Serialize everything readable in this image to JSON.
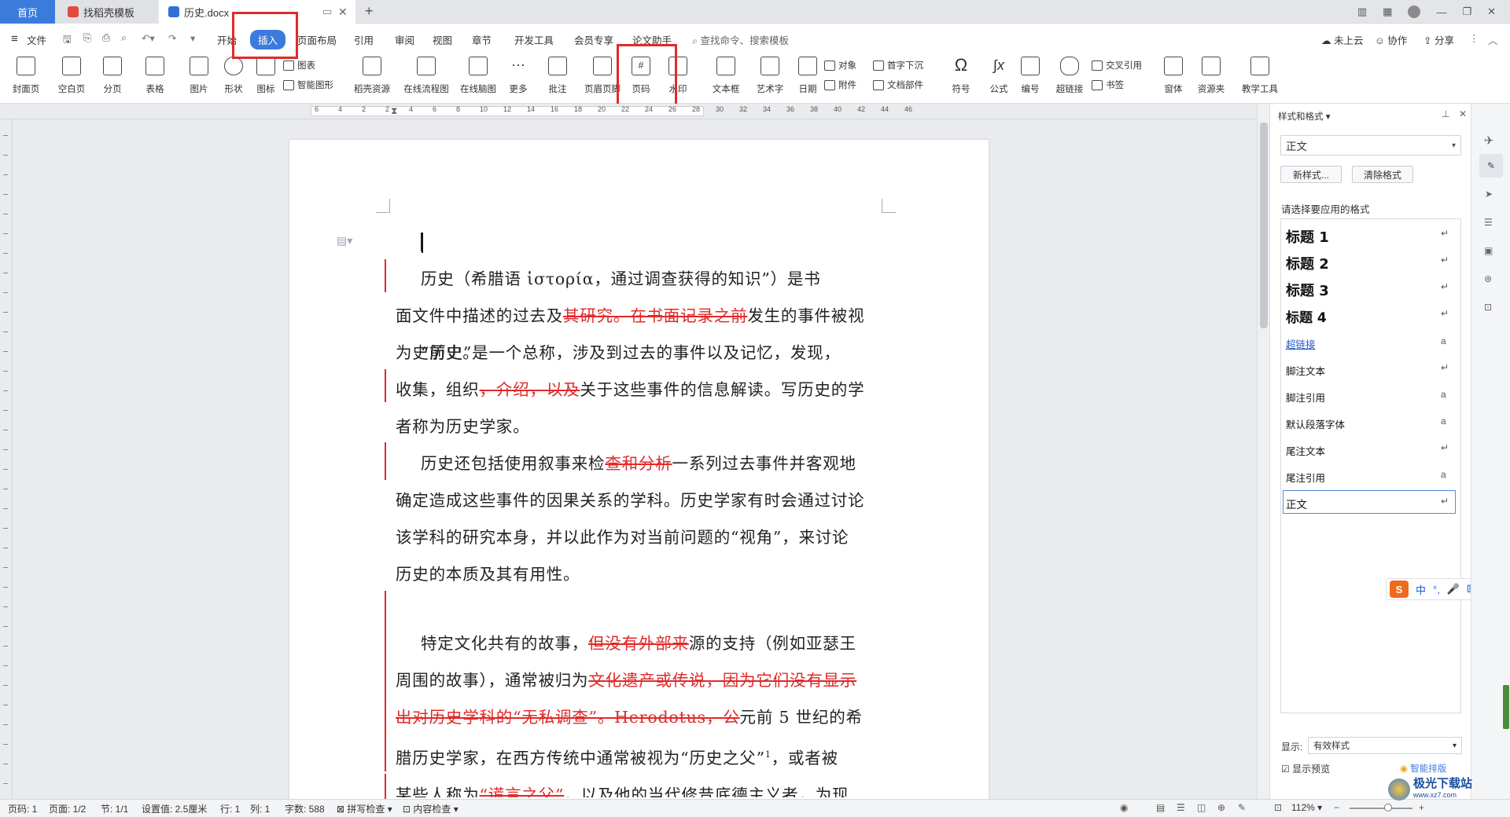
{
  "tabs": {
    "home": "首页",
    "template": "找稻壳模板",
    "doc": "历史.docx"
  },
  "menu": {
    "file": "文件",
    "items": [
      "开始",
      "插入",
      "页面布局",
      "引用",
      "审阅",
      "视图",
      "章节",
      "开发工具",
      "会员专享",
      "论文助手"
    ],
    "active": "插入",
    "search": "查找命令、搜索模板",
    "cloud": "未上云",
    "collab": "协作",
    "share": "分享"
  },
  "ribbon": {
    "cover": "封面页",
    "blank": "空白页",
    "pagebreak": "分页",
    "table": "表格",
    "picture": "图片",
    "shape": "形状",
    "icon": "图标",
    "chart": "图表",
    "smartart": "智能图形",
    "docer": "稻壳资源",
    "flowchart": "在线流程图",
    "mindmap": "在线脑图",
    "more": "更多",
    "comment": "批注",
    "header": "页眉页脚",
    "pagenum": "页码",
    "watermark": "水印",
    "textbox": "文本框",
    "wordart": "艺术字",
    "date": "日期",
    "object": "对象",
    "attach": "附件",
    "dropcap": "首字下沉",
    "docparts": "文档部件",
    "symbol": "符号",
    "formula": "公式",
    "numbering": "编号",
    "hyperlink": "超链接",
    "crossref": "交叉引用",
    "bookmark": "书签",
    "window": "窗体",
    "resources": "资源夹",
    "teaching": "教学工具"
  },
  "ruler": {
    "marks": [
      "6",
      "4",
      "2",
      "2",
      "4",
      "6",
      "8",
      "10",
      "12",
      "14",
      "16",
      "18",
      "20",
      "22",
      "24",
      "26",
      "28",
      "30",
      "32",
      "34",
      "36",
      "38",
      "40",
      "42",
      "44",
      "46"
    ]
  },
  "document": {
    "p1": [
      "历史（希腊语 ἱστορία，通过调查获得的知识”）是书",
      "面文件中描述的过去及",
      "其研究。在书面记录之前",
      "发生的事件被视",
      "为史前史。"
    ],
    "p2": [
      "“历史”是一个总称，涉及到过去的事件以及记忆，发现，",
      "收集，组织",
      "，介绍，以及",
      "关于这些事件的信息解读。写历史的学",
      "者称为历史学家。"
    ],
    "p3": [
      "历史还包括使用叙事来检",
      "查和分析",
      "一系列过去事件并客观地",
      "确定造成这些事件的因果关系的学科。历史学家有时会通过讨论",
      "该学科的研究本身，并以此作为对当前问题的“视角”，来讨论",
      "历史的本质及其有用性。"
    ],
    "p4": [
      "特定文化共有的故事，",
      "但没有外部来",
      "源的支持（例如亚瑟王",
      "周围的故事），通常被归为",
      "文化遗产或传说，因为它们没有显示",
      "出对历史学科的“无私调查”。Herodotus，公",
      "元前 5 世纪的希",
      "腊历史学家，在西方传统中通常被视为“历史之父”",
      "1",
      "，或者被",
      "某些人称为",
      "“谎言之父”",
      "，以及他的当代修昔底德主义者，为现"
    ]
  },
  "panel": {
    "title": "样式和格式",
    "current": "正文",
    "new_style": "新样式...",
    "clear": "清除格式",
    "prompt": "请选择要应用的格式",
    "styles": [
      "标题  1",
      "标题  2",
      "标题  3",
      "标题  4",
      "超链接",
      "脚注文本",
      "脚注引用",
      "默认段落字体",
      "尾注文本",
      "尾注引用",
      "正文"
    ],
    "show_label": "显示:",
    "show_value": "有效样式",
    "preview": "显示预览",
    "smart": "智能排版"
  },
  "ime": {
    "lang": "中"
  },
  "status": {
    "page": "页码: 1",
    "pages": "页面: 1/2",
    "section": "节: 1/1",
    "setting": "设置值: 2.5厘米",
    "row": "行: 1",
    "col": "列: 1",
    "words": "字数: 588",
    "spell": "拼写检查",
    "content": "内容检查",
    "zoom": "112%"
  },
  "watermark": "极光下载站",
  "watermark_url": "www.xz7.com",
  "colors": {
    "accent": "#3b7bdc",
    "revision": "#e02a2a",
    "highlight_box": "#e02a2a"
  }
}
